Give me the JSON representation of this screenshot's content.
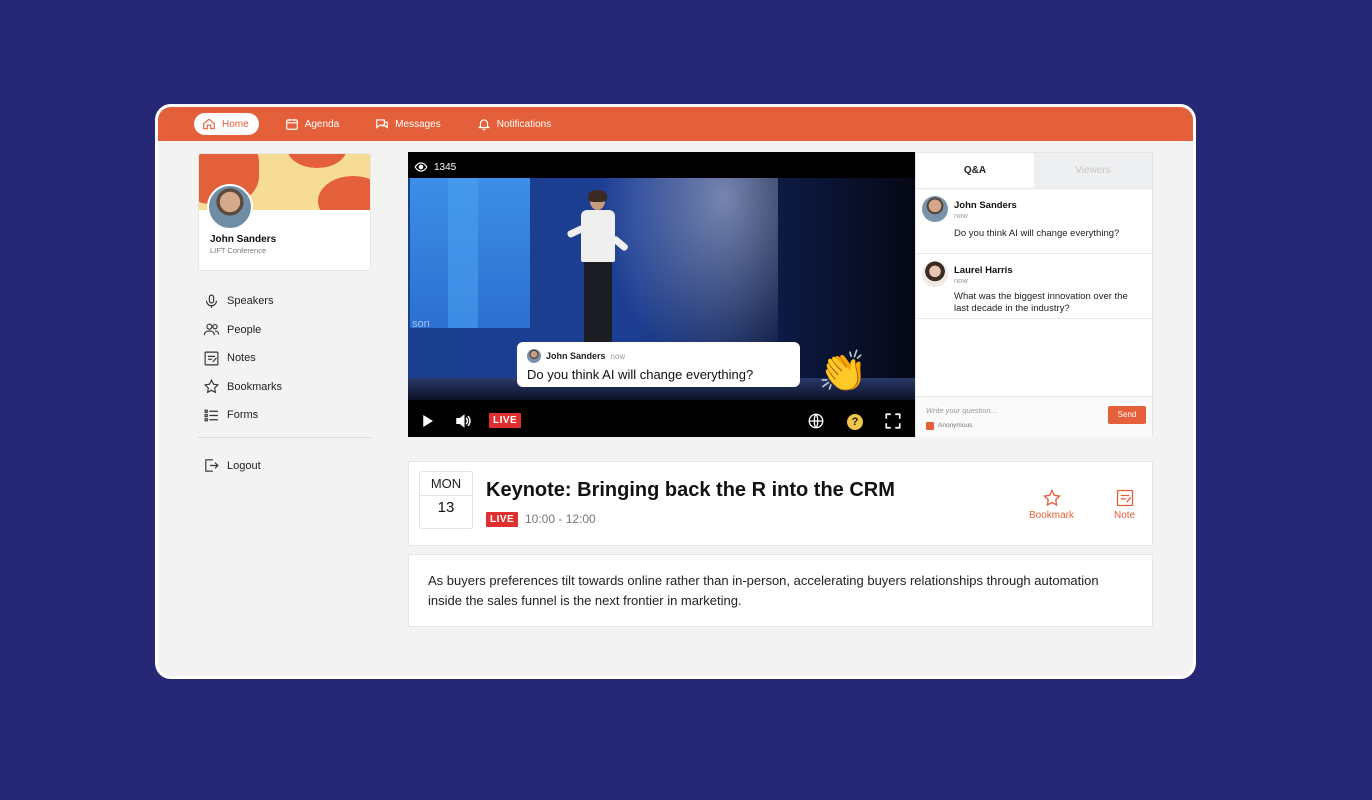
{
  "nav": {
    "items": [
      {
        "label": "Home",
        "icon": "home-icon",
        "active": true
      },
      {
        "label": "Agenda",
        "icon": "calendar-icon",
        "active": false
      },
      {
        "label": "Messages",
        "icon": "messages-icon",
        "active": false
      },
      {
        "label": "Notifications",
        "icon": "bell-icon",
        "active": false
      }
    ]
  },
  "profile": {
    "name": "John Sanders",
    "subtitle": "LIFT Conference"
  },
  "sidebar": {
    "items": [
      {
        "label": "Speakers",
        "icon": "microphone-icon"
      },
      {
        "label": "People",
        "icon": "people-icon"
      },
      {
        "label": "Notes",
        "icon": "notes-icon"
      },
      {
        "label": "Bookmarks",
        "icon": "star-icon"
      },
      {
        "label": "Forms",
        "icon": "list-icon"
      }
    ],
    "logout_label": "Logout"
  },
  "video": {
    "viewer_count": "1345",
    "stage_text": "son",
    "live_label": "LIVE",
    "help_glyph": "?",
    "bubble": {
      "name": "John Sanders",
      "time": "now",
      "message": "Do you think AI will change everything?"
    }
  },
  "qa": {
    "tabs": [
      {
        "label": "Q&A",
        "active": true
      },
      {
        "label": "Viewers",
        "active": false
      }
    ],
    "questions": [
      {
        "name": "John Sanders",
        "time": "now",
        "question": "Do you think AI will change everything?"
      },
      {
        "name": "Laurel Harris",
        "time": "now",
        "question": "What was the biggest innovation over the last decade in the industry?"
      }
    ],
    "input_placeholder": "Write your question...",
    "anonymous_label": "Anonymous",
    "send_label": "Send"
  },
  "session": {
    "day_of_week": "MON",
    "day": "13",
    "title": "Keynote: Bringing back the R into the CRM",
    "live_label": "LIVE",
    "time": "10:00 - 12:00",
    "bookmark_label": "Bookmark",
    "note_label": "Note",
    "description": "As buyers preferences tilt towards online rather than in-person, accelerating buyers relationships through automation inside the sales funnel is the next frontier in marketing."
  },
  "colors": {
    "accent": "#e4603a",
    "background": "#262876",
    "live": "#e02f2f"
  }
}
